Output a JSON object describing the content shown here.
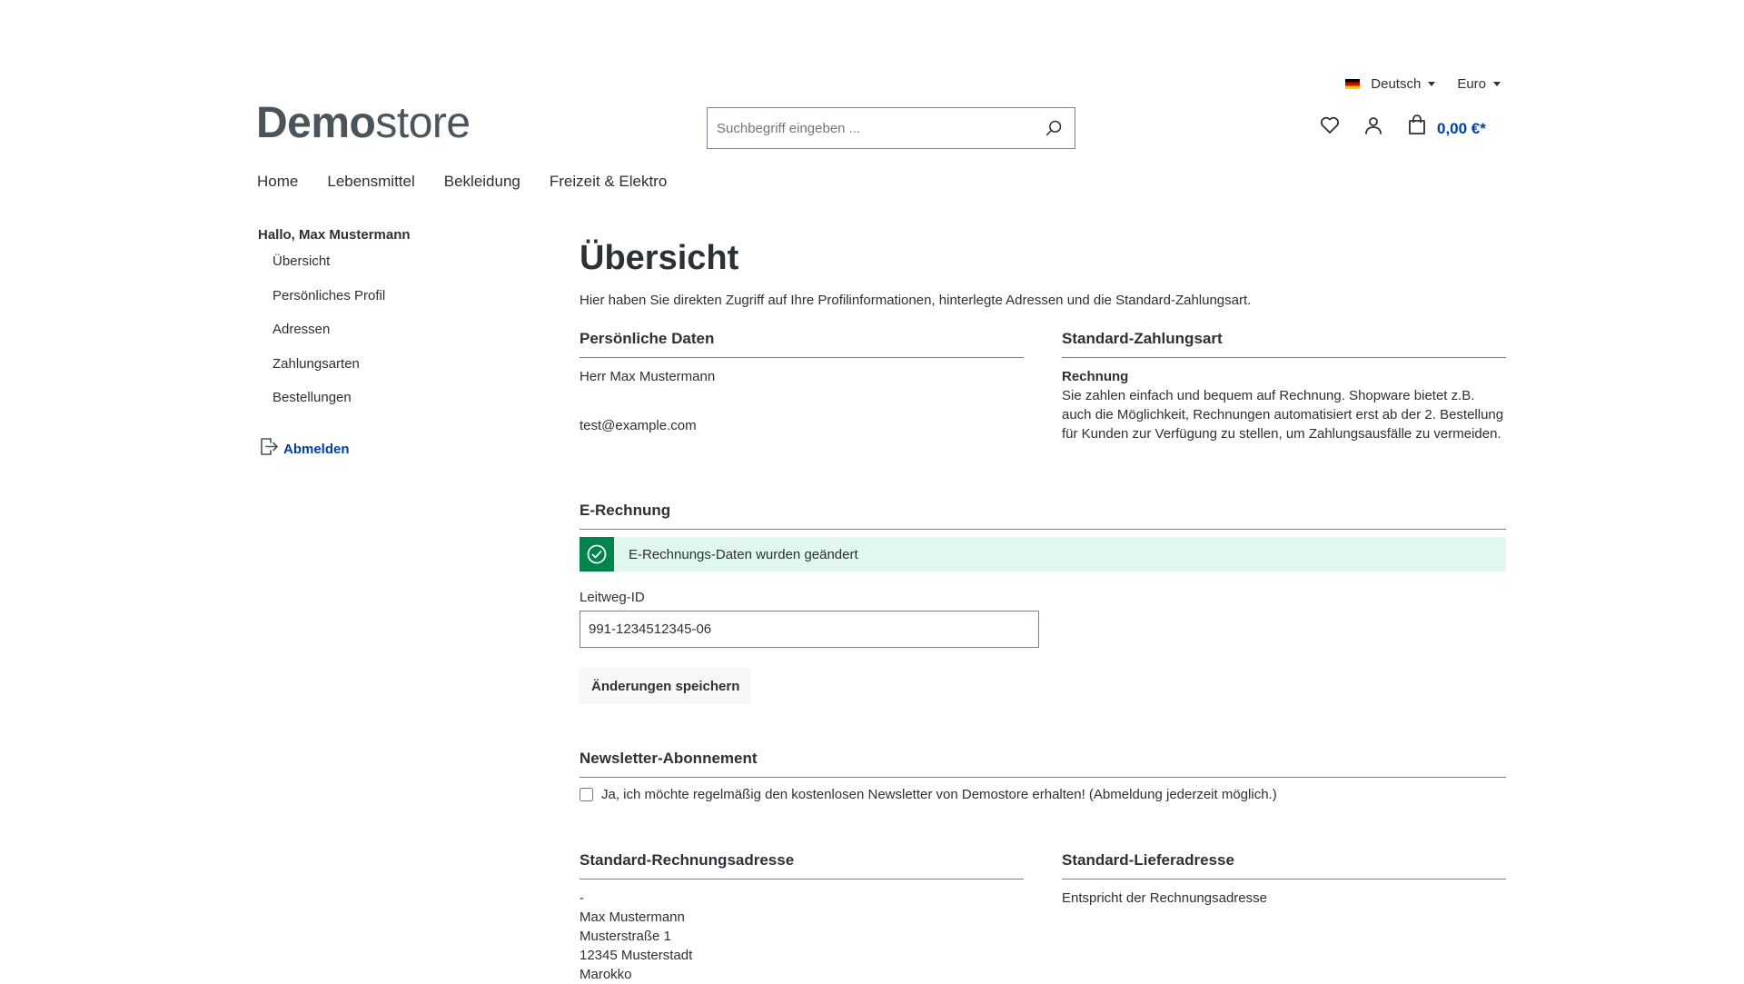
{
  "topbar": {
    "language": "Deutsch",
    "currency": "Euro"
  },
  "logo": {
    "bold": "Demo",
    "light": "store"
  },
  "search": {
    "placeholder": "Suchbegriff eingeben ..."
  },
  "header": {
    "cart_total": "0,00 €*"
  },
  "nav": {
    "items": [
      "Home",
      "Lebensmittel",
      "Bekleidung",
      "Freizeit & Elektro"
    ]
  },
  "sidebar": {
    "greeting": "Hallo, Max Mustermann",
    "items": [
      "Übersicht",
      "Persönliches Profil",
      "Adressen",
      "Zahlungsarten",
      "Bestellungen"
    ],
    "logout": "Abmelden"
  },
  "main": {
    "title": "Übersicht",
    "intro": "Hier haben Sie direkten Zugriff auf Ihre Profilinformationen, hinterlegte Adressen und die Standard-Zahlungsart.",
    "personal": {
      "title": "Persönliche Daten",
      "name": "Herr Max Mustermann",
      "email": "test@example.com"
    },
    "payment": {
      "title": "Standard-Zahlungsart",
      "method": "Rechnung",
      "description": "Sie zahlen einfach und bequem auf Rechnung. Shopware bietet z.B. auch die Möglichkeit, Rechnungen automatisiert erst ab der 2. Bestellung für Kunden zur Verfügung zu stellen, um Zahlungsausfälle zu vermeiden."
    },
    "einvoice": {
      "title": "E-Rechnung",
      "alert": "E-Rechnungs-Daten wurden geändert",
      "label": "Leitweg-ID",
      "value": "991-1234512345-06",
      "save": "Änderungen speichern"
    },
    "newsletter": {
      "title": "Newsletter-Abonnement",
      "label": "Ja, ich möchte regelmäßig den kostenlosen Newsletter von Demostore erhalten! (Abmeldung jederzeit möglich.)",
      "checked": false
    },
    "billing": {
      "title": "Standard-Rechnungsadresse",
      "lines": [
        "-",
        "Max Mustermann",
        "Musterstraße 1",
        "12345 Musterstadt",
        "Marokko"
      ]
    },
    "shipping": {
      "title": "Standard-Lieferadresse",
      "text": "Entspricht der Rechnungsadresse"
    }
  },
  "colors": {
    "accent": "#0042a0",
    "success": "#00844d",
    "success_bg": "#e0f7ee",
    "text": "#2b3136"
  },
  "icons": [
    "germany-flag-icon",
    "search-icon",
    "heart-icon",
    "user-icon",
    "shopping-bag-icon",
    "logout-icon",
    "check-circle-icon"
  ]
}
